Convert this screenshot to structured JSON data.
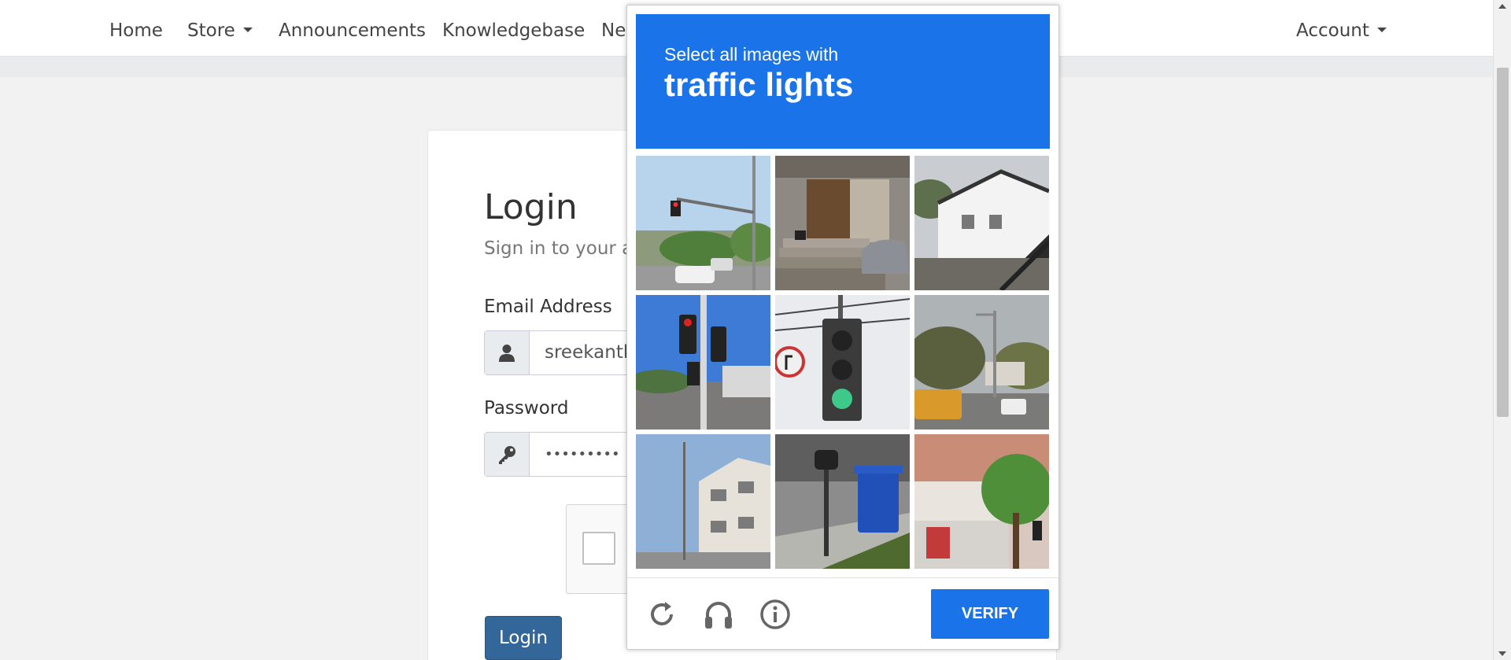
{
  "nav": {
    "items": [
      {
        "label": "Home"
      },
      {
        "label": "Store"
      },
      {
        "label": "Announcements"
      },
      {
        "label": "Knowledgebase"
      },
      {
        "label": "Net"
      }
    ],
    "account_label": "Account"
  },
  "login": {
    "title": "Login",
    "subtitle": "Sign in to your a",
    "email_label": "Email Address",
    "email_value": "sreekanth",
    "password_label": "Password",
    "password_value": "•••••••••",
    "button_label": "Login"
  },
  "captcha": {
    "prompt": "Select all images with",
    "target": "traffic lights",
    "verify_label": "VERIFY",
    "accent_color": "#1a73e8",
    "tiles": [
      {
        "name": "tile-traffic-light-street"
      },
      {
        "name": "tile-house-entrance-car"
      },
      {
        "name": "tile-white-house-stairs"
      },
      {
        "name": "tile-traffic-lights-pole"
      },
      {
        "name": "tile-green-traffic-light"
      },
      {
        "name": "tile-street-school-bus"
      },
      {
        "name": "tile-buildings-street"
      },
      {
        "name": "tile-mailbox-bin"
      },
      {
        "name": "tile-shopfront-tree"
      }
    ],
    "footer_icons": [
      "reload-icon",
      "audio-icon",
      "info-icon"
    ]
  }
}
